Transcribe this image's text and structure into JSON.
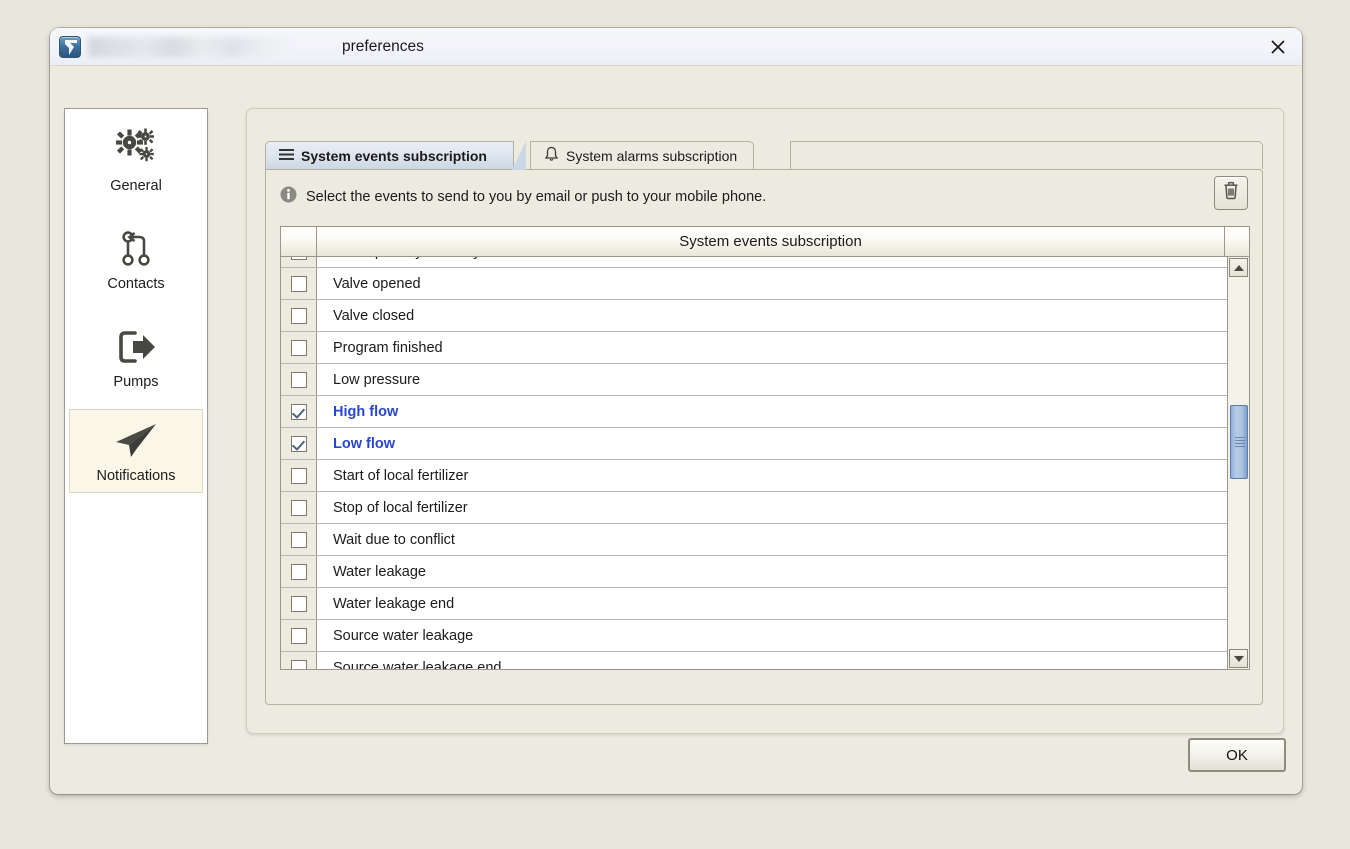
{
  "window": {
    "title_suffix": "preferences",
    "app_icon": "app-logo-icon",
    "close_icon": "close-icon"
  },
  "sidebar": {
    "items": [
      {
        "label": "General",
        "icon": "gears-icon",
        "active": false
      },
      {
        "label": "Contacts",
        "icon": "contacts-branch-icon",
        "active": false
      },
      {
        "label": "Pumps",
        "icon": "pump-exit-arrow-icon",
        "active": false
      },
      {
        "label": "Notifications",
        "icon": "paper-plane-icon",
        "active": true
      }
    ]
  },
  "tabs": [
    {
      "label": "System events subscription",
      "icon": "list-lines-icon",
      "active": true
    },
    {
      "label": "System alarms subscription",
      "icon": "bell-icon",
      "active": false
    }
  ],
  "panel": {
    "info_text": "Select the events to send to you by email or push to your mobile phone.",
    "info_icon": "info-icon",
    "delete_button_icon": "trash-icon"
  },
  "table": {
    "column_header": "System events subscription",
    "checkbox_column_header": "",
    "rows": [
      {
        "label": "Interrupted by new day start",
        "checked": false,
        "highlighted": false
      },
      {
        "label": "Valve opened",
        "checked": false,
        "highlighted": false
      },
      {
        "label": "Valve closed",
        "checked": false,
        "highlighted": false
      },
      {
        "label": "Program finished",
        "checked": false,
        "highlighted": false
      },
      {
        "label": "Low pressure",
        "checked": false,
        "highlighted": false
      },
      {
        "label": "High flow",
        "checked": true,
        "highlighted": true
      },
      {
        "label": "Low flow",
        "checked": true,
        "highlighted": true
      },
      {
        "label": "Start of local fertilizer",
        "checked": false,
        "highlighted": false
      },
      {
        "label": "Stop of local fertilizer",
        "checked": false,
        "highlighted": false
      },
      {
        "label": "Wait due to conflict",
        "checked": false,
        "highlighted": false
      },
      {
        "label": "Water leakage",
        "checked": false,
        "highlighted": false
      },
      {
        "label": "Water leakage end",
        "checked": false,
        "highlighted": false
      },
      {
        "label": "Source water leakage",
        "checked": false,
        "highlighted": false
      },
      {
        "label": "Source water leakage end",
        "checked": false,
        "highlighted": false
      }
    ]
  },
  "scrollbar": {
    "up_icon": "scroll-up-arrow-icon",
    "down_icon": "scroll-down-arrow-icon"
  },
  "footer": {
    "ok_label": "OK"
  },
  "colors": {
    "selected_row_text": "#2a45cf",
    "window_background": "#edebe0",
    "desktop_background": "#e9e7dd",
    "active_tab": "#ccd7e5",
    "scroll_thumb": "#a9c1e0"
  }
}
